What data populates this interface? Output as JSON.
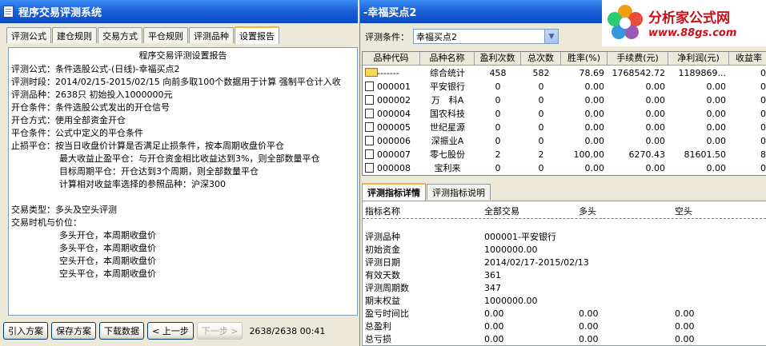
{
  "left_window": {
    "title": "程序交易评测系统",
    "tabs": [
      "评测公式",
      "建仓规则",
      "交易方式",
      "平仓规则",
      "评测品种",
      "设置报告"
    ],
    "active_tab": 5,
    "report": {
      "title": "程序交易评测设置报告",
      "lines": [
        "评测公式：条件选股公式-(日线)-幸福买点2",
        "评测时段：2014/02/15-2015/02/15 向前多取100个数据用于计算 强制平仓计入收",
        "评测品种：2638只 初始投入1000000元",
        "开仓条件：条件选股公式发出的开仓信号",
        "开仓方式：使用全部资金开仓",
        "平仓条件：公式中定义的平仓条件",
        "止损平仓：按当日收盘价计算是否满足止损条件，按本周期收盘价平仓",
        "最大收益止盈平仓：与开仓资金相比收益达到3%，则全部数量平仓",
        "目标周期平仓：开仓达到3个周期，则全部数量平仓",
        "计算相对收益率选择的参照品种：沪深300",
        "交易类型：多头及空头评测",
        "交易时机与价位：",
        "多头开仓，本周期收盘价",
        "多头平仓，本周期收盘价",
        "空头开仓，本周期收盘价",
        "空头平仓，本周期收盘价"
      ]
    },
    "buttons": {
      "import": "引入方案",
      "save": "保存方案",
      "download": "下载数据",
      "prev": "< 上一步",
      "next": "下一步 >"
    },
    "status": "2638/2638 00:41"
  },
  "right_window": {
    "title": "-幸福买点2",
    "condition_label": "评测条件：",
    "condition_value": "幸福买点2",
    "table": {
      "headers": [
        "品种代码",
        "品种名称",
        "盈利次数",
        "总次数",
        "胜率(%)",
        "手续费(元)",
        "净利润(元)",
        "收益率"
      ],
      "rows": [
        [
          "-------",
          "综合统计",
          "458",
          "582",
          "78.69",
          "1768542.72",
          "1189869...",
          "0"
        ],
        [
          "000001",
          "平安银行",
          "0",
          "0",
          "0.00",
          "0.00",
          "0.00",
          "0"
        ],
        [
          "000002",
          "万　科A",
          "0",
          "0",
          "0.00",
          "0.00",
          "0.00",
          "0"
        ],
        [
          "000004",
          "国农科技",
          "0",
          "0",
          "0.00",
          "0.00",
          "0.00",
          "0"
        ],
        [
          "000005",
          "世纪星源",
          "0",
          "0",
          "0.00",
          "0.00",
          "0.00",
          "0"
        ],
        [
          "000006",
          "深振业A",
          "0",
          "0",
          "0.00",
          "0.00",
          "0.00",
          "0"
        ],
        [
          "000007",
          "零七股份",
          "2",
          "2",
          "100.00",
          "6270.43",
          "81601.50",
          "8"
        ],
        [
          "000008",
          "宝利来",
          "0",
          "0",
          "0.00",
          "0.00",
          "0.00",
          "0"
        ]
      ]
    },
    "detail_tabs": [
      "评测指标详情",
      "评测指标说明"
    ],
    "detail": {
      "headers": [
        "指标名称",
        "全部交易",
        "多头",
        "空头"
      ],
      "rows": [
        [
          "评测品种",
          "000001-平安银行",
          "",
          ""
        ],
        [
          "初始资金",
          "1000000.00",
          "",
          ""
        ],
        [
          "评测日期",
          "2014/02/17-2015/02/13",
          "",
          ""
        ],
        [
          "有效天数",
          "361",
          "",
          ""
        ],
        [
          "评测周期数",
          "347",
          "",
          ""
        ],
        [
          "期末权益",
          "1000000.00",
          "",
          ""
        ],
        [
          "盈亏时间比",
          "0.00",
          "0.00",
          "0.00"
        ],
        [
          "总盈利",
          "0.00",
          "0.00",
          "0.00"
        ],
        [
          "总亏损",
          "0.00",
          "0.00",
          "0.00"
        ]
      ]
    }
  },
  "logo": {
    "main": "分析家公式网",
    "url": "www.88gs.com"
  },
  "colors": {
    "titlebar": "#0b4bc4",
    "logo_red": "#c8101a",
    "tab_highlight": "#f3b33d"
  }
}
